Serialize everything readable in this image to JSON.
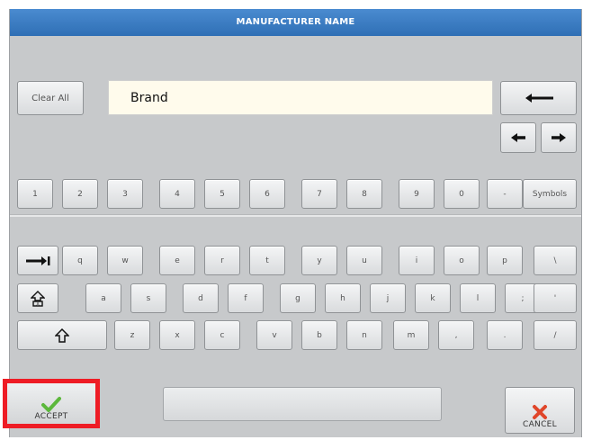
{
  "dialog": {
    "title": "MANUFACTURER NAME"
  },
  "input": {
    "clear_label": "Clear All",
    "value": "Brand"
  },
  "controls": {
    "backspace_icon": "backspace-arrow-icon",
    "left_icon": "left-arrow-icon",
    "right_icon": "right-arrow-icon"
  },
  "numbers": [
    "1",
    "2",
    "3",
    "4",
    "5",
    "6",
    "7",
    "8",
    "9",
    "0",
    "-",
    "Symbols"
  ],
  "rows": {
    "row1": [
      "q",
      "w",
      "e",
      "r",
      "t",
      "y",
      "u",
      "i",
      "o",
      "p",
      "\\"
    ],
    "row2": [
      "a",
      "s",
      "d",
      "f",
      "g",
      "h",
      "j",
      "k",
      "l",
      ";",
      "'"
    ],
    "row3": [
      "z",
      "x",
      "c",
      "v",
      "b",
      "n",
      "m",
      ",",
      ".",
      "/"
    ]
  },
  "footer": {
    "accept_label": "ACCEPT",
    "cancel_label": "CANCEL"
  },
  "colors": {
    "title_bar": "#2f6fb5",
    "highlight": "#ee1c25",
    "accept_check": "#5cb83c",
    "cancel_x": "#e0462a"
  }
}
